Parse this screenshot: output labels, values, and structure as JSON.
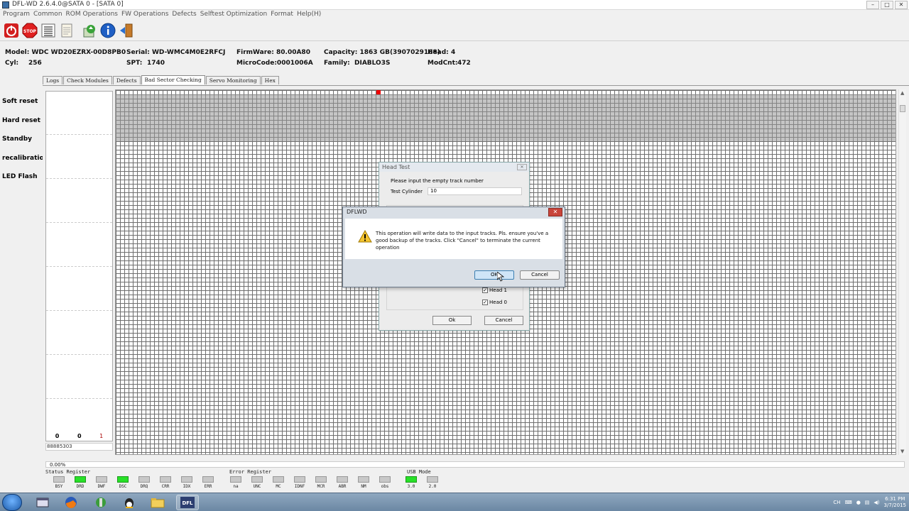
{
  "window": {
    "title": "DFL-WD 2.6.4.0@SATA 0 - [SATA 0]"
  },
  "menu": [
    "Program",
    "Common",
    "ROM Operations",
    "FW Operations",
    "Defects",
    "Selftest  Optimization",
    "Format",
    "Help(H)"
  ],
  "drive_info": {
    "model": "Model: WDC WD20EZRX-00D8PB0",
    "cyl": "Cyl:",
    "cyl_value": "256",
    "serial": "Serial: WD-WMC4M0E2RFCJ",
    "spt": "SPT:",
    "spt_value": "1740",
    "firmware": "FirmWare: 80.00A80",
    "microcode": "MicroCode:0001006A",
    "capacity": "Capacity: 1863 GB(3907029168)",
    "family": "Family:",
    "family_value": "DIABLO3S",
    "head": "Head:",
    "head_value": "4",
    "modcnt": "ModCnt:",
    "modcnt_value": "472"
  },
  "actions": [
    "Soft reset",
    "Hard reset",
    "Standby",
    "recalibration",
    "LED Flash"
  ],
  "tabs": [
    {
      "label": "Logs"
    },
    {
      "label": "Check Modules"
    },
    {
      "label": "Defects"
    },
    {
      "label": "Bad Sector Checking"
    },
    {
      "label": "Servo Monitoring"
    },
    {
      "label": "Hex"
    }
  ],
  "active_tab": "Bad Sector Checking",
  "stats": {
    "count_a": "0",
    "count_b": "0",
    "count_c": "1",
    "lba": "88885303"
  },
  "progress": {
    "text": "0.00%"
  },
  "registers": {
    "status_label": "Status Register",
    "status": [
      {
        "name": "BSY",
        "on": false
      },
      {
        "name": "DRD",
        "on": true
      },
      {
        "name": "DWF",
        "on": false
      },
      {
        "name": "DSC",
        "on": true
      },
      {
        "name": "DRQ",
        "on": false
      },
      {
        "name": "CRR",
        "on": false
      },
      {
        "name": "IDX",
        "on": false
      },
      {
        "name": "ERR",
        "on": false
      }
    ],
    "error_label": "Error Register",
    "error": [
      {
        "name": "na",
        "on": false
      },
      {
        "name": "UNC",
        "on": false
      },
      {
        "name": "MC",
        "on": false
      },
      {
        "name": "IDNF",
        "on": false
      },
      {
        "name": "MCR",
        "on": false
      },
      {
        "name": "ABR",
        "on": false
      },
      {
        "name": "NM",
        "on": false
      },
      {
        "name": "obs",
        "on": false
      }
    ],
    "usb_label": "USB Mode",
    "usb": [
      {
        "name": "3.0",
        "on": true
      },
      {
        "name": "2.0",
        "on": false
      }
    ]
  },
  "head_test_dialog": {
    "title": "Head Test",
    "prompt": "Please input the empty track number",
    "cylinder_label": "Test Cylinder",
    "cylinder_value": "10",
    "heads": [
      {
        "label": "Head 1",
        "checked": true
      },
      {
        "label": "Head 0",
        "checked": true
      }
    ],
    "ok_label": "Ok",
    "cancel_label": "Cancel"
  },
  "confirm_dialog": {
    "title": "DFLWD",
    "message": "This operation will write data to the input tracks. Pls. ensure you've a good backup of the tracks. Click \"Cancel\" to terminate the current operation",
    "ok_label": "OK",
    "cancel_label": "Cancel",
    "close_glyph": "✕"
  },
  "taskbar": {
    "lang": "CH",
    "time": "6:31 PM",
    "date": "3/7/2015"
  },
  "colors": {
    "led_on": "#28e028",
    "led_off": "#c8c8c8",
    "grid_line": "#6f6f6f",
    "marker": "#e00000"
  }
}
